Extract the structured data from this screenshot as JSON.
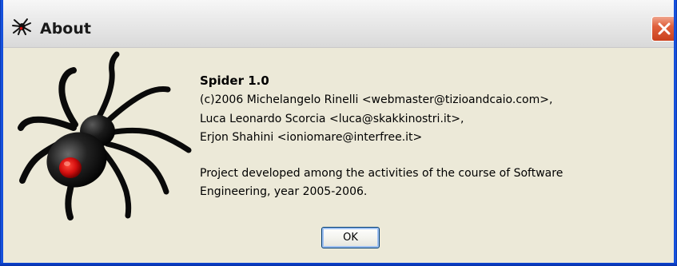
{
  "window": {
    "title": "About",
    "icon": "spider-icon",
    "close_icon": "close-icon"
  },
  "about": {
    "app_name": "Spider 1.0",
    "authors": [
      "(c)2006 Michelangelo Rinelli <webmaster@tizioandcaio.com>,",
      "Luca Leonardo Scorcia <luca@skakkinostri.it>,",
      "Erjon Shahini <ioniomare@interfree.it>"
    ],
    "description": [
      "Project developed among the activities of the course of Software",
      "Engineering, year 2005-2006."
    ],
    "image": "spider-logo"
  },
  "buttons": {
    "ok_label": "OK"
  },
  "colors": {
    "dialog_background": "#ece9d8",
    "close_button": "#e0603c",
    "frame_blue": "#0a3cc9"
  }
}
